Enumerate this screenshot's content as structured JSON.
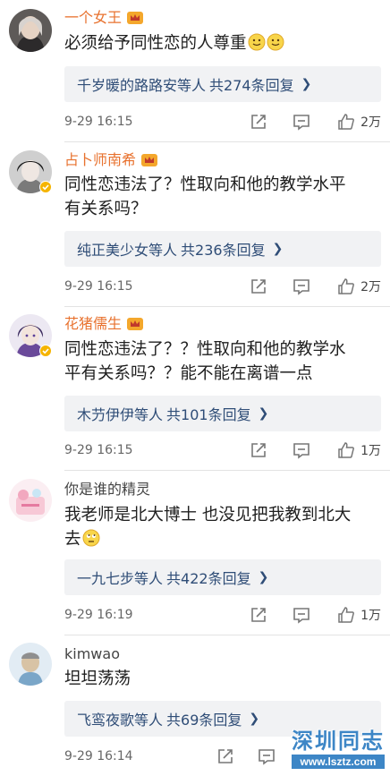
{
  "comments": [
    {
      "username": "一个女王",
      "text_lines": [
        "必须给予同性恋的人尊重"
      ],
      "emojis": [
        "smile-emoji",
        "smile-emoji"
      ],
      "reply_users": "千岁暖的路路安",
      "reply_suffix": "等人",
      "reply_count": "共274条回复",
      "time": "9-29 16:15",
      "likes": "2万"
    },
    {
      "username": "占卜师南希",
      "text_lines": [
        "同性恋违法了？性取向和他的教学水平",
        "有关系吗？"
      ],
      "reply_users": "纯正美少女",
      "reply_suffix": "等人",
      "reply_count": "共236条回复",
      "time": "9-29 16:15",
      "likes": "2万"
    },
    {
      "username": "花猪儒生",
      "text_lines": [
        "同性恋违法了？？性取向和他的教学水",
        "平有关系吗？？能不能在离谱一点"
      ],
      "reply_users": "木芀伊伊",
      "reply_suffix": "等人",
      "reply_count": "共101条回复",
      "time": "9-29 16:15",
      "likes": "1万"
    },
    {
      "username": "你是谁的精灵",
      "text_lines": [
        "我老师是北大博士 也没见把我教到北大",
        "去"
      ],
      "emojis": [
        "eyeroll-emoji"
      ],
      "reply_users": "一九七步",
      "reply_suffix": "等人",
      "reply_count": "共422条回复",
      "time": "9-29 16:19",
      "likes": "1万"
    },
    {
      "username": "kimwao",
      "text_lines": [
        "坦坦荡荡"
      ],
      "reply_users": "飞鸾夜歌",
      "reply_suffix": "等人",
      "reply_count": "共69条回复",
      "time": "9-29 16:14",
      "likes": ""
    }
  ],
  "icons": {
    "share": "share-icon",
    "comment": "comment-icon",
    "like": "thumbs-up-icon",
    "chevron": "chevron-right-icon",
    "crown": "vip-crown-icon",
    "verified": "verified-badge-icon"
  },
  "watermark": {
    "title": "深圳同志",
    "url": "www.lsztz.com"
  },
  "colors": {
    "vip_name": "#e8722f",
    "reply_link": "#2f4d77",
    "reply_bg": "#f1f2f4",
    "watermark": "#3d86c6"
  }
}
